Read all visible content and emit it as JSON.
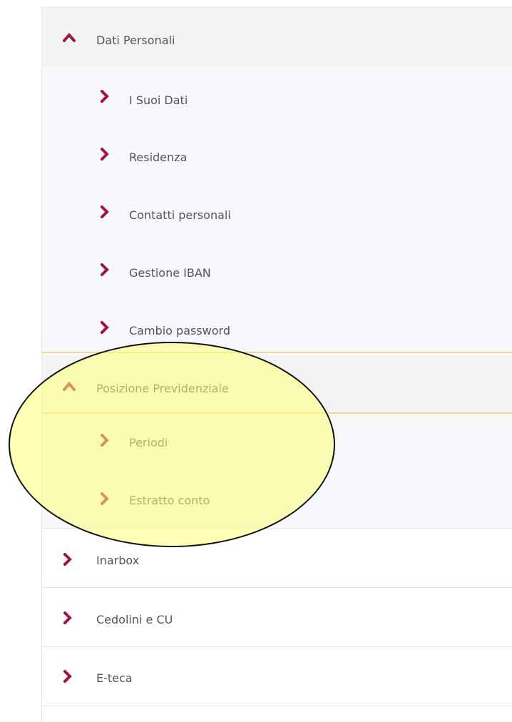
{
  "menu": {
    "sections": [
      {
        "label": "Dati Personali",
        "items": [
          {
            "label": "I Suoi Dati"
          },
          {
            "label": "Residenza"
          },
          {
            "label": "Contatti personali"
          },
          {
            "label": "Gestione IBAN"
          },
          {
            "label": "Cambio password"
          }
        ]
      },
      {
        "label": "Posizione Previdenziale",
        "items": [
          {
            "label": "Periodi"
          },
          {
            "label": "Estratto conto"
          }
        ]
      }
    ],
    "top_items": [
      {
        "label": "Inarbox"
      },
      {
        "label": "Cedolini e CU"
      },
      {
        "label": "E-teca"
      }
    ]
  },
  "icons": {
    "expanded": "chevron-up-icon",
    "collapsed": "chevron-right-icon"
  },
  "colors": {
    "accent": "#a3163a",
    "text": "#555555",
    "header_bg": "#f3f3f3",
    "submenu_bg": "#f6f8fb",
    "highlight": "#ffff78",
    "highlight_border": "#f5d98a"
  }
}
